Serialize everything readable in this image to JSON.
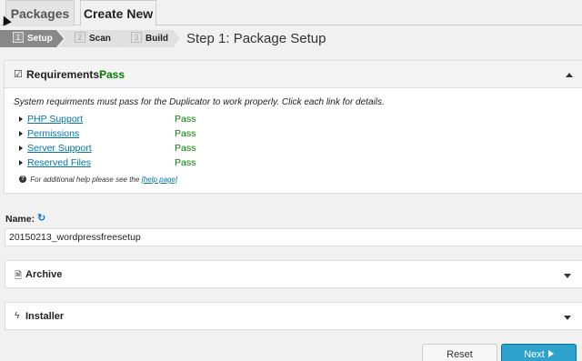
{
  "tabs": [
    {
      "label": "Packages"
    },
    {
      "label": "Create New"
    }
  ],
  "wizard": {
    "steps": [
      {
        "number": "1",
        "label": "Setup"
      },
      {
        "number": "2",
        "label": "Scan"
      },
      {
        "number": "3",
        "label": "Build"
      }
    ],
    "title": "Step 1: Package Setup"
  },
  "requirements": {
    "title": "Requirements:",
    "status": "Pass",
    "description": "System requirments must pass for the Duplicator to work properly. Click each link for details.",
    "items": [
      {
        "label": "PHP Support",
        "status": "Pass"
      },
      {
        "label": "Permissions",
        "status": "Pass"
      },
      {
        "label": "Server Support",
        "status": "Pass"
      },
      {
        "label": "Reserved Files",
        "status": "Pass"
      }
    ],
    "help_text": "For additional help please see the",
    "help_link": "[help page]"
  },
  "name_field": {
    "label": "Name:",
    "value": "20150213_wordpressfreesetup"
  },
  "panels": {
    "archive": {
      "label": "Archive"
    },
    "installer": {
      "label": "Installer"
    }
  },
  "buttons": {
    "reset": "Reset",
    "next": "Next"
  },
  "colors": {
    "pass": "#008000",
    "link": "#0073aa",
    "primary": "#2ea2cc"
  },
  "icons": [
    "checkbox-icon",
    "collapse-up-icon",
    "help-icon",
    "refresh-icon",
    "archive-file-icon",
    "bolt-icon",
    "expand-down-icon",
    "next-arrow-icon"
  ]
}
